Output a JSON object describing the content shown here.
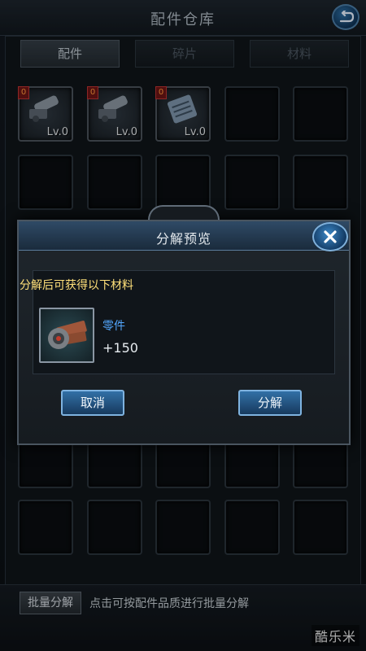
{
  "header": {
    "title": "配件仓库"
  },
  "tabs": [
    {
      "label": "配件",
      "active": true
    },
    {
      "label": "碎片",
      "active": false
    },
    {
      "label": "材料",
      "active": false
    }
  ],
  "items": [
    {
      "count": "0",
      "level": "Lv.0",
      "icon": "cannon-icon"
    },
    {
      "count": "0",
      "level": "Lv.0",
      "icon": "cannon-icon"
    },
    {
      "count": "0",
      "level": "Lv.0",
      "icon": "armor-plate-icon"
    }
  ],
  "modal": {
    "title": "分解预览",
    "subtitle": "分解后可获得以下材料",
    "reward_name": "零件",
    "reward_qty": "+150",
    "cancel_label": "取消",
    "confirm_label": "分解"
  },
  "bottom": {
    "batch_label": "批量分解",
    "hint": "点击可按配件品质进行批量分解"
  },
  "watermark": "酷乐米",
  "colors": {
    "accent_blue": "#2e6ea6",
    "badge_red": "#6b1414",
    "highlight_yellow": "#ffe07a",
    "reward_blue": "#53a8ff"
  }
}
